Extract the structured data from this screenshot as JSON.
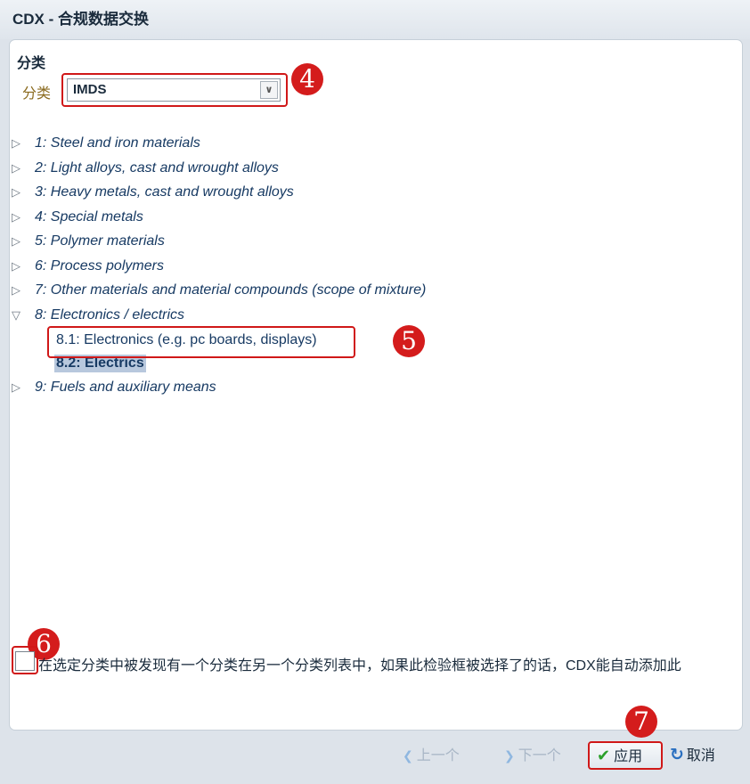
{
  "window": {
    "title": "CDX - 合规数据交换"
  },
  "section": {
    "title": "分类"
  },
  "classification": {
    "label": "分类",
    "selected": "IMDS"
  },
  "tree": {
    "items": [
      {
        "label": "1: Steel and iron materials"
      },
      {
        "label": "2: Light alloys, cast and wrought alloys"
      },
      {
        "label": "3: Heavy metals, cast and wrought alloys"
      },
      {
        "label": "4: Special metals"
      },
      {
        "label": "5: Polymer materials"
      },
      {
        "label": "6: Process polymers"
      },
      {
        "label": "7: Other materials and material compounds (scope of mixture)"
      },
      {
        "label": "8: Electronics / electrics",
        "children": [
          {
            "label": "8.1: Electronics (e.g. pc boards, displays)"
          },
          {
            "label": "8.2: Electrics"
          }
        ]
      },
      {
        "label": "9: Fuels and auxiliary means"
      }
    ]
  },
  "auto_add": {
    "text": "在选定分类中被发现有一个分类在另一个分类列表中，如果此检验框被选择了的话，CDX能自动添加此"
  },
  "footer": {
    "prev": "上一个",
    "next": "下一个",
    "apply": "应用",
    "cancel": "取消"
  },
  "markers": {
    "m4": "4",
    "m5": "5",
    "m6": "6",
    "m7": "7"
  },
  "icons": {
    "expand": "triangle-right-icon",
    "collapse": "triangle-down-icon",
    "prev": "chevron-left-icon",
    "next": "chevron-right-icon",
    "apply": "checkmark-icon",
    "cancel": "refresh-icon"
  },
  "colors": {
    "callout": "#d01818",
    "selected_bg": "#b8c8dd",
    "link_text": "#173a63"
  }
}
